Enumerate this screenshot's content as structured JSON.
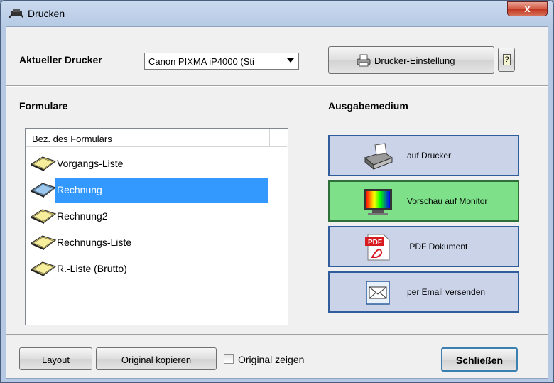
{
  "window": {
    "title": "Drucken",
    "close_glyph": "x",
    "app_icon": "printer-app-icon"
  },
  "printer": {
    "label": "Aktueller Drucker",
    "selected": "Canon PIXMA iP4000 (Sti",
    "settings_label": "Drucker-Einstellung",
    "help_glyph": "?"
  },
  "forms": {
    "heading": "Formulare",
    "column_header": "Bez. des Formulars",
    "items": [
      {
        "label": "Vorgangs-Liste",
        "selected": false
      },
      {
        "label": "Rechnung",
        "selected": true
      },
      {
        "label": "Rechnung2",
        "selected": false
      },
      {
        "label": "Rechnungs-Liste",
        "selected": false
      },
      {
        "label": "R.-Liste (Brutto)",
        "selected": false
      }
    ]
  },
  "output": {
    "heading": "Ausgabemedium",
    "options": [
      {
        "label": "auf Drucker",
        "icon": "printer-icon",
        "active": false
      },
      {
        "label": "Vorschau auf Monitor",
        "icon": "monitor-icon",
        "active": true
      },
      {
        "label": ".PDF Dokument",
        "icon": "pdf-icon",
        "active": false
      },
      {
        "label": "per Email versenden",
        "icon": "email-icon",
        "active": false
      }
    ]
  },
  "footer": {
    "layout_label": "Layout",
    "copy_label": "Original kopieren",
    "show_original_label": "Original zeigen",
    "show_original_checked": false,
    "close_label": "Schließen"
  },
  "colors": {
    "selection": "#3399ff",
    "active_output": "#7ee18a",
    "output_bg": "#cad3e8",
    "output_border": "#2e5c9c"
  }
}
